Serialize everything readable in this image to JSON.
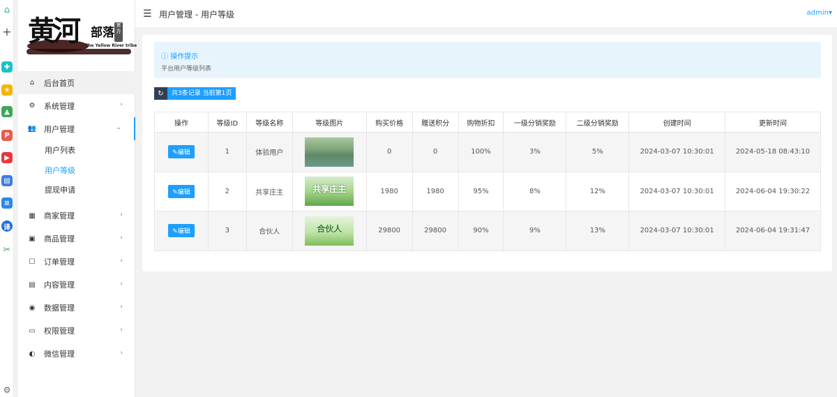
{
  "header": {
    "breadcrumb": "用户管理 - 用户等级",
    "user": "admin"
  },
  "logo": {
    "title_big": "黄河",
    "title_small": "部落",
    "seal": "官方",
    "english": "The Yellow River tribe"
  },
  "sidebar": {
    "items": [
      {
        "label": "后台首页",
        "icon": "home-icon"
      },
      {
        "label": "系统管理",
        "icon": "gear-icon"
      },
      {
        "label": "用户管理",
        "icon": "users-icon"
      },
      {
        "label": "商家管理",
        "icon": "store-icon"
      },
      {
        "label": "商品管理",
        "icon": "bag-icon"
      },
      {
        "label": "订单管理",
        "icon": "clipboard-icon"
      },
      {
        "label": "内容管理",
        "icon": "file-icon"
      },
      {
        "label": "数据管理",
        "icon": "database-icon"
      },
      {
        "label": "权限管理",
        "icon": "monitor-icon"
      },
      {
        "label": "微信管理",
        "icon": "wechat-icon"
      }
    ],
    "user_sub": [
      "用户列表",
      "用户等级",
      "提现申请"
    ]
  },
  "tip": {
    "title": "操作提示",
    "text": "平台用户等级列表"
  },
  "stat": {
    "text": "共3条记录 当前第1页"
  },
  "table": {
    "headers": [
      "操作",
      "等级ID",
      "等级名称",
      "等级图片",
      "购买价格",
      "赠送积分",
      "购物折扣",
      "一级分销奖励",
      "二级分销奖励",
      "创建时间",
      "更新时间"
    ],
    "edit_label": "编辑",
    "rows": [
      {
        "id": "1",
        "name": "体验用户",
        "image_caption": "",
        "price": "0",
        "points": "0",
        "discount": "100%",
        "lv1": "3%",
        "lv2": "5%",
        "created": "2024-03-07 10:30:01",
        "updated": "2024-05-18 08:43:10"
      },
      {
        "id": "2",
        "name": "共享庄主",
        "image_caption": "共享庄主",
        "price": "1980",
        "points": "1980",
        "discount": "95%",
        "lv1": "8%",
        "lv2": "12%",
        "created": "2024-03-07 10:30:01",
        "updated": "2024-06-04 19:30:22"
      },
      {
        "id": "3",
        "name": "合伙人",
        "image_caption": "合伙人",
        "price": "29800",
        "points": "29800",
        "discount": "90%",
        "lv1": "9%",
        "lv2": "13%",
        "created": "2024-03-07 10:30:01",
        "updated": "2024-06-04 19:31:47"
      }
    ]
  },
  "colors": {
    "accent": "#1e9fff",
    "tip_bg": "#e8f4fc",
    "dark": "#2f4056"
  }
}
